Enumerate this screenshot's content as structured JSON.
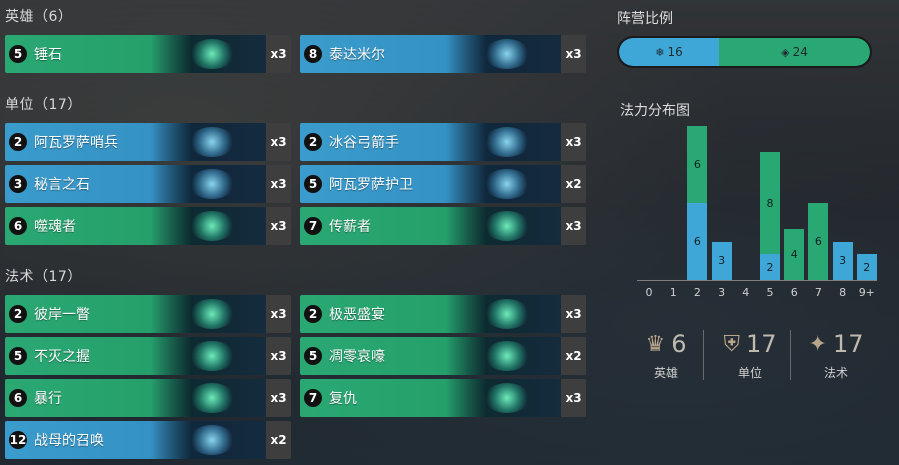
{
  "sections": {
    "champions": "英雄（6）",
    "units": "单位（17）",
    "spells": "法术（17）"
  },
  "champions": [
    {
      "cost": "5",
      "name": "锤石",
      "count": "x3",
      "region": "green"
    },
    {
      "cost": "8",
      "name": "泰达米尔",
      "count": "x3",
      "region": "blue"
    }
  ],
  "units": [
    {
      "cost": "2",
      "name": "阿瓦罗萨哨兵",
      "count": "x3",
      "region": "blue"
    },
    {
      "cost": "2",
      "name": "冰谷弓箭手",
      "count": "x3",
      "region": "blue"
    },
    {
      "cost": "3",
      "name": "秘言之石",
      "count": "x3",
      "region": "blue"
    },
    {
      "cost": "5",
      "name": "阿瓦罗萨护卫",
      "count": "x2",
      "region": "blue"
    },
    {
      "cost": "6",
      "name": "噬魂者",
      "count": "x3",
      "region": "green"
    },
    {
      "cost": "7",
      "name": "传薪者",
      "count": "x3",
      "region": "green"
    }
  ],
  "spells": [
    {
      "cost": "2",
      "name": "彼岸一瞥",
      "count": "x3",
      "region": "green"
    },
    {
      "cost": "2",
      "name": "极恶盛宴",
      "count": "x3",
      "region": "green"
    },
    {
      "cost": "5",
      "name": "不灭之握",
      "count": "x3",
      "region": "green"
    },
    {
      "cost": "5",
      "name": "凋零哀嚎",
      "count": "x2",
      "region": "green"
    },
    {
      "cost": "6",
      "name": "暴行",
      "count": "x3",
      "region": "green"
    },
    {
      "cost": "7",
      "name": "复仇",
      "count": "x3",
      "region": "green"
    },
    {
      "cost": "12",
      "name": "战母的召唤",
      "count": "x2",
      "region": "blue"
    }
  ],
  "faction": {
    "title": "阵营比例",
    "blue_value": "16",
    "green_value": "24",
    "blue_icon": "freljord-icon",
    "green_icon": "shadow-isles-icon",
    "colors": {
      "blue": "#3fa6d8",
      "green": "#2aa873"
    }
  },
  "mana": {
    "title": "法力分布图"
  },
  "chart_data": {
    "type": "bar",
    "categories": [
      "0",
      "1",
      "2",
      "3",
      "4",
      "5",
      "6",
      "7",
      "8",
      "9+"
    ],
    "series": [
      {
        "color": "#3fa6d8",
        "values": [
          0,
          0,
          6,
          3,
          0,
          2,
          0,
          0,
          3,
          2
        ]
      },
      {
        "color": "#2aa873",
        "values": [
          0,
          0,
          6,
          0,
          0,
          8,
          4,
          6,
          0,
          0
        ]
      }
    ],
    "stacked": true
  },
  "stats": [
    {
      "value": "6",
      "label": "英雄",
      "icon": "champion-icon"
    },
    {
      "value": "17",
      "label": "单位",
      "icon": "unit-icon"
    },
    {
      "value": "17",
      "label": "法术",
      "icon": "spell-icon"
    }
  ]
}
